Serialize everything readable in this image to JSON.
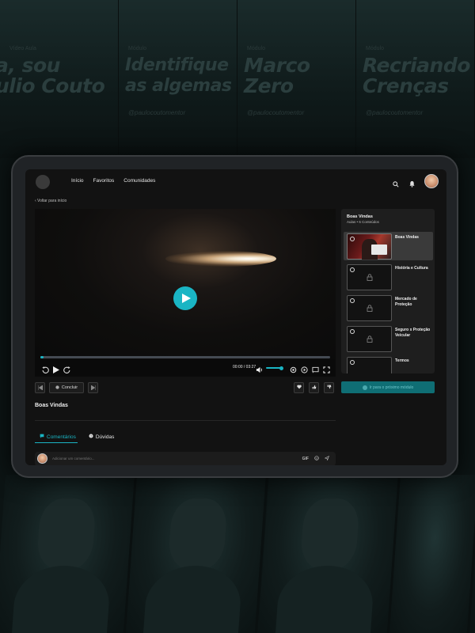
{
  "background": {
    "posters": [
      {
        "tag": "Vídeo Aula",
        "title": "a, sou\nulio Couto",
        "handle": ""
      },
      {
        "tag": "Módulo",
        "title": "Identifique\nas algemas",
        "handle": "@paulocoutomentor"
      },
      {
        "tag": "Módulo",
        "title": "Marco\nZero",
        "handle": "@paulocoutomentor"
      },
      {
        "tag": "Módulo",
        "title": "Recriando\nCrenças",
        "handle": "@paulocoutomentor"
      }
    ]
  },
  "nav": {
    "links": [
      "Início",
      "Favoritos",
      "Comunidades"
    ],
    "search_icon": "search-icon",
    "bell_icon": "bell-icon"
  },
  "back_link": "‹ Voltar para início",
  "player": {
    "time": "00:00 / 03:27",
    "progress": 0.01,
    "volume": 0.9,
    "accent": "#1ab5c4"
  },
  "actions": {
    "complete_label": "Concluir"
  },
  "lesson": {
    "title": "Boas Vindas"
  },
  "tabs": {
    "comments": "Comentários",
    "doubts": "Dúvidas"
  },
  "comment": {
    "placeholder": "Adicionar um comentário...",
    "gif_label": "GIF"
  },
  "sidebar": {
    "title": "Boas Vindas",
    "subtitle": "Aulas • 6 Conteúdos",
    "items": [
      {
        "label": "Boas Vindas",
        "locked": false,
        "active": true
      },
      {
        "label": "História e Cultura",
        "locked": true,
        "active": false
      },
      {
        "label": "Mercado de Proteção",
        "locked": true,
        "active": false
      },
      {
        "label": "Seguro x Proteção Veicular",
        "locked": true,
        "active": false
      },
      {
        "label": "Termos",
        "locked": true,
        "active": false
      }
    ],
    "next_label": "Ir para o próximo módulo"
  }
}
